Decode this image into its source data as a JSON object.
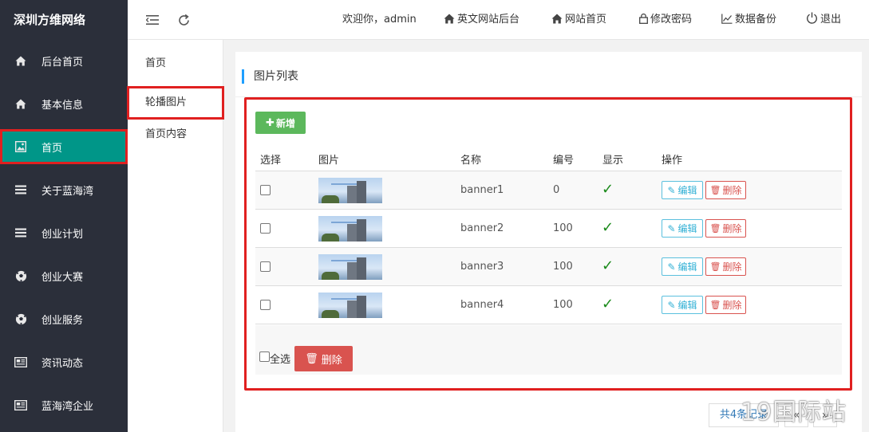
{
  "brand": "深圳方维网络",
  "sidebar": {
    "items": [
      {
        "label": "后台首页",
        "icon": "home-icon"
      },
      {
        "label": "基本信息",
        "icon": "home-icon"
      },
      {
        "label": "首页",
        "icon": "image-icon"
      },
      {
        "label": "关于蓝海湾",
        "icon": "list-icon"
      },
      {
        "label": "创业计划",
        "icon": "list-icon"
      },
      {
        "label": "创业大赛",
        "icon": "soccer-ball-icon"
      },
      {
        "label": "创业服务",
        "icon": "soccer-ball-icon"
      },
      {
        "label": "资讯动态",
        "icon": "newspaper-icon"
      },
      {
        "label": "蓝海湾企业",
        "icon": "newspaper-icon"
      }
    ],
    "active_index": 2
  },
  "header": {
    "welcome": "欢迎你，admin",
    "links": [
      {
        "label": "英文网站后台",
        "icon": "home-icon"
      },
      {
        "label": "网站首页",
        "icon": "home-icon"
      },
      {
        "label": "修改密码",
        "icon": "lock-icon"
      },
      {
        "label": "数据备份",
        "icon": "line-chart-icon"
      },
      {
        "label": "退出",
        "icon": "power-icon"
      }
    ]
  },
  "subnav": {
    "items": [
      "首页",
      "轮播图片",
      "首页内容"
    ],
    "active_index": 1
  },
  "panel": {
    "title": "图片列表",
    "add_label": "新增",
    "columns": [
      "选择",
      "图片",
      "名称",
      "编号",
      "显示",
      "操作"
    ],
    "rows": [
      {
        "name": "banner1",
        "number": "0",
        "shown": true
      },
      {
        "name": "banner2",
        "number": "100",
        "shown": true
      },
      {
        "name": "banner3",
        "number": "100",
        "shown": true
      },
      {
        "name": "banner4",
        "number": "100",
        "shown": true
      }
    ],
    "edit_label": "编辑",
    "delete_label": "删除",
    "select_all_label": "全选",
    "bulk_delete_label": "删除"
  },
  "pager": {
    "total": "共4条记录",
    "prev": "«",
    "next": "»"
  },
  "watermark": "19国际站",
  "colors": {
    "sidebar_bg": "#2b2f3a",
    "active": "#009688",
    "highlight": "#e02020",
    "add": "#5cb85c",
    "danger": "#d9534f",
    "info": "#5bc0de"
  }
}
